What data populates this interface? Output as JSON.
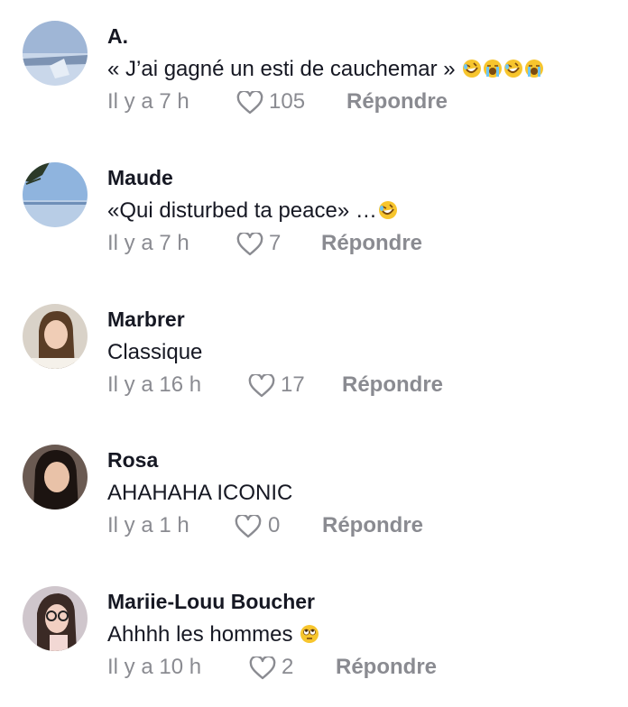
{
  "comments": [
    {
      "username": "A.",
      "text": "« J’ai gagné un esti de cauchemar »",
      "emojis": [
        "rofl",
        "sob",
        "rofl",
        "sob"
      ],
      "time": "Il y a 7 h",
      "likes": "105",
      "reply": "Répondre"
    },
    {
      "username": "Maude",
      "text": "«Qui disturbed ta peace» …",
      "emojis": [
        "rofl"
      ],
      "time": "Il y a 7 h",
      "likes": "7",
      "reply": "Répondre"
    },
    {
      "username": "Marbrer",
      "text": "Classique",
      "emojis": [],
      "time": "Il y a 16 h",
      "likes": "17",
      "reply": "Répondre"
    },
    {
      "username": "Rosa",
      "text": "AHAHAHA ICONIC",
      "emojis": [],
      "time": "Il y a 1 h",
      "likes": "0",
      "reply": "Répondre"
    },
    {
      "username": "Mariie-Louu Boucher",
      "text": "Ahhhh les hommes",
      "emojis": [
        "eyeroll"
      ],
      "time": "Il y a 10 h",
      "likes": "2",
      "reply": "Répondre"
    }
  ],
  "colors": {
    "text": "#161823",
    "muted": "#8a8b91"
  }
}
